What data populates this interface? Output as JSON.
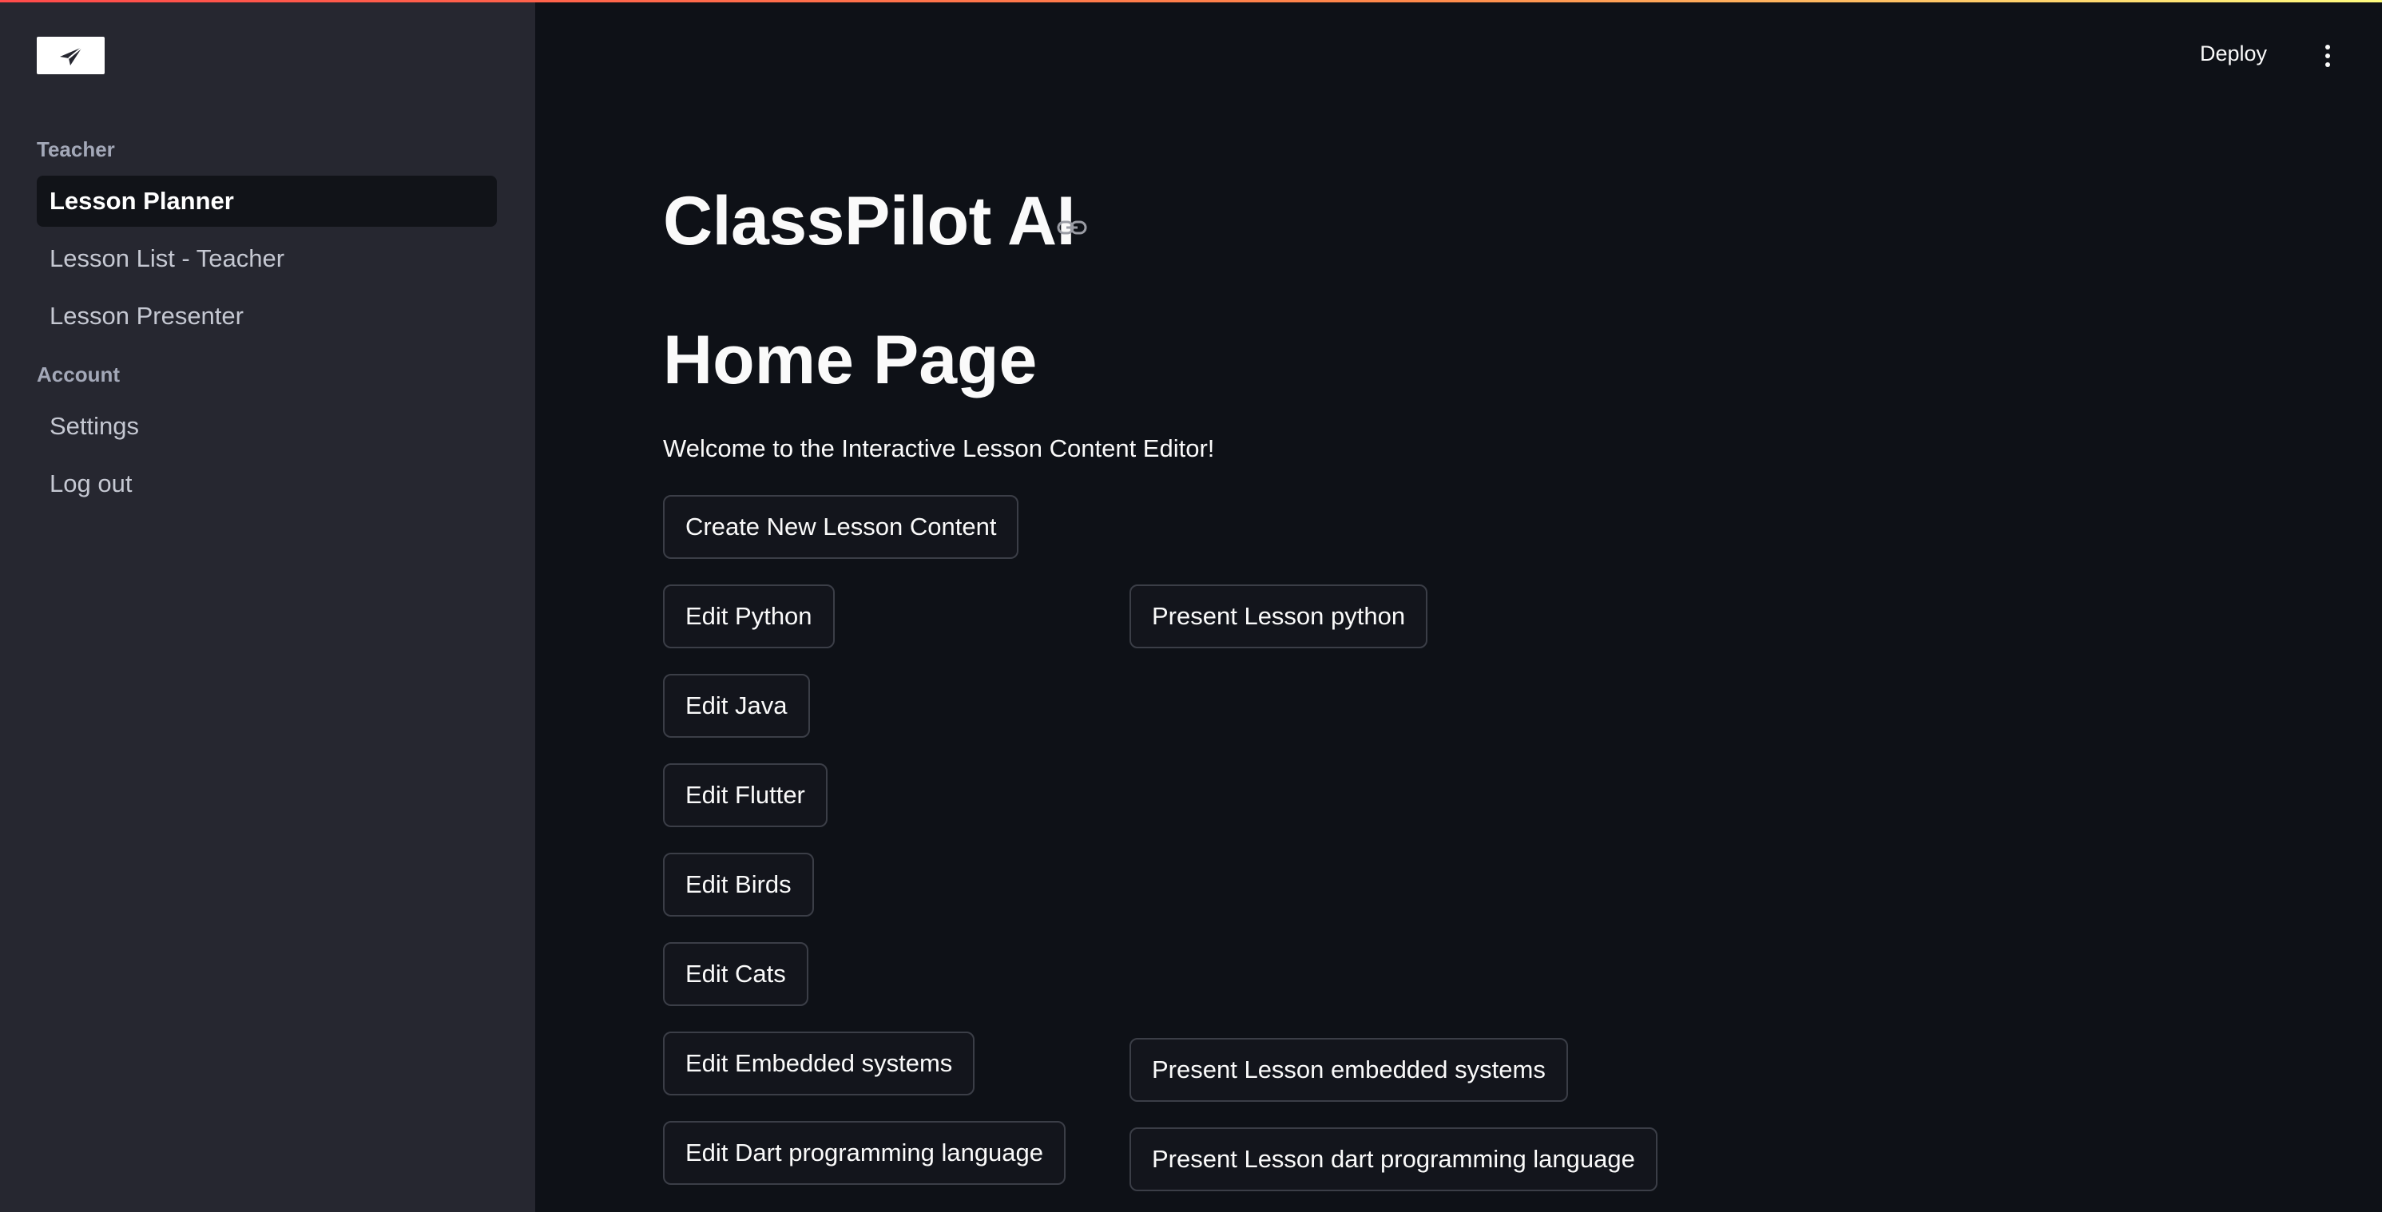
{
  "sidebar": {
    "logo_icon": "paper-plane-icon",
    "sections": [
      {
        "title": "Teacher",
        "items": [
          {
            "label": "Lesson Planner",
            "active": true
          },
          {
            "label": "Lesson List - Teacher",
            "active": false
          },
          {
            "label": "Lesson Presenter",
            "active": false
          }
        ]
      },
      {
        "title": "Account",
        "items": [
          {
            "label": "Settings",
            "active": false
          },
          {
            "label": "Log out",
            "active": false
          }
        ]
      }
    ]
  },
  "header": {
    "deploy_label": "Deploy",
    "menu_icon": "kebab-menu-icon"
  },
  "main": {
    "title": "ClassPilot AI",
    "heading": "Home Page",
    "welcome_text": "Welcome to the Interactive Lesson Content Editor!",
    "create_button": "Create New Lesson Content",
    "edit_buttons": [
      "Edit Python",
      "Edit Java",
      "Edit Flutter",
      "Edit Birds",
      "Edit Cats",
      "Edit Embedded systems",
      "Edit Dart programming language"
    ],
    "present_buttons": [
      "Present Lesson python",
      "Present Lesson embedded systems",
      "Present Lesson dart programming language"
    ]
  },
  "colors": {
    "background": "#0e1117",
    "sidebar": "#262730",
    "button_border": "#3b3e47",
    "accent_gradient_start": "#ff4b4b"
  }
}
